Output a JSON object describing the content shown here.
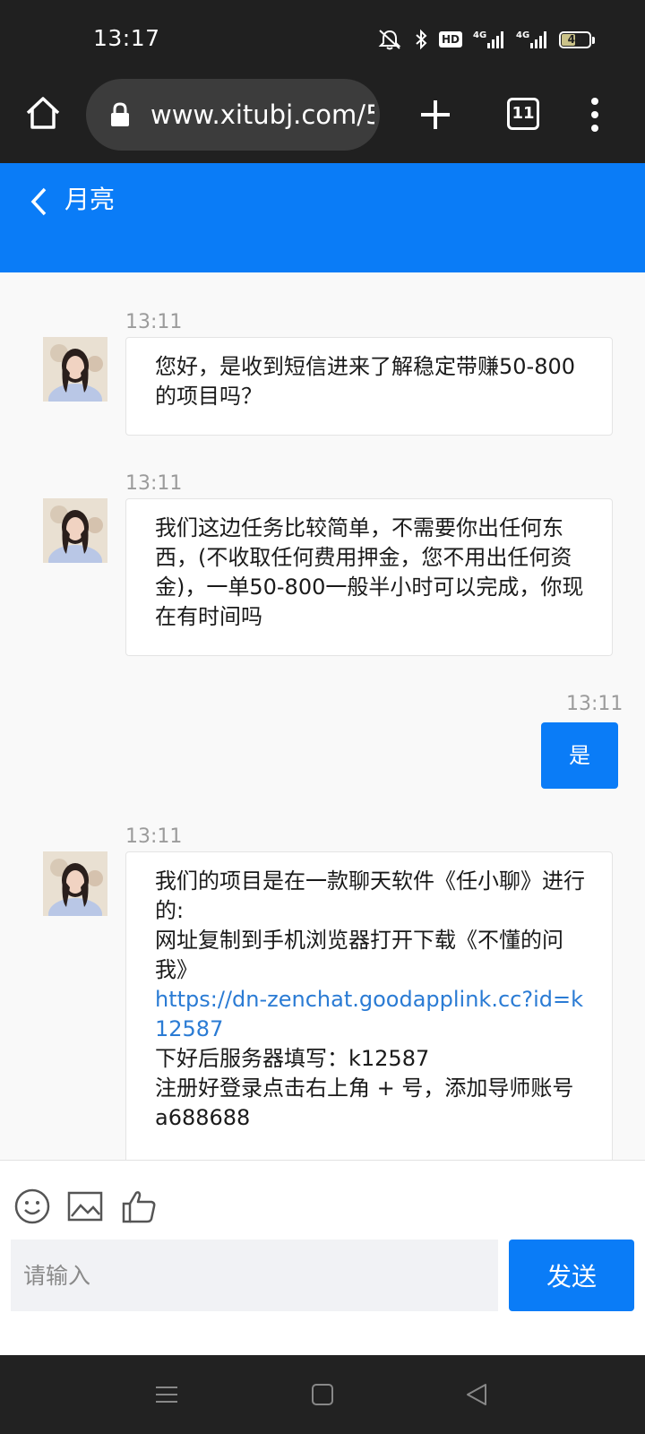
{
  "status_bar": {
    "time": "13:17",
    "network_1": "4G",
    "network_2": "4G",
    "hd": "HD",
    "battery_level": 49,
    "battery_text": "49"
  },
  "browser": {
    "url": "www.xitubj.com/5",
    "tab_count": "11"
  },
  "chat": {
    "title": "月亮",
    "messages": [
      {
        "from": "them",
        "time": "13:11",
        "text": "您好，是收到短信进来了解稳定带赚50-800的项目吗？"
      },
      {
        "from": "them",
        "time": "13:11",
        "text": "我们这边任务比较简单，不需要你出任何东西，(不收取任何费用押金，您不用出任何资金)，一单50-800一般半小时可以完成，你现在有时间吗"
      },
      {
        "from": "me",
        "time": "13:11",
        "text": "是"
      },
      {
        "from": "them",
        "time": "13:11",
        "text_before": "我们的项目是在一款聊天软件《任小聊》进行的:\n网址复制到手机浏览器打开下载《不懂的问我》",
        "link": "https://dn-zenchat.goodapplink.cc?id=k12587",
        "text_after": "下好后服务器填写：k12587\n注册好登录点击右上角 + 号，添加导师账号 a688688"
      }
    ]
  },
  "composer": {
    "placeholder": "请输入",
    "send_label": "发送"
  },
  "colors": {
    "accent": "#0a7cf7",
    "link": "#2a7bd4",
    "status_bg": "#202020"
  },
  "icons": [
    "home-icon",
    "lock-icon",
    "plus-icon",
    "menu-dots-icon",
    "back-chevron-icon",
    "emoji-icon",
    "image-icon",
    "thumbs-up-icon",
    "nav-recent-icon",
    "nav-home-icon",
    "nav-back-icon"
  ]
}
